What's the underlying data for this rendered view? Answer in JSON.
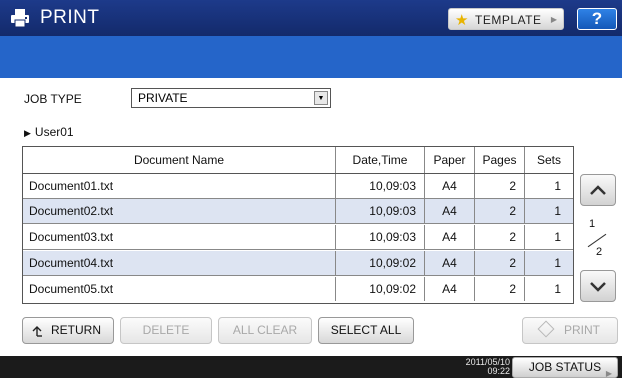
{
  "header": {
    "title": "PRINT",
    "title_icon": "printer-icon",
    "template_label": "TEMPLATE",
    "template_icon": "star-icon",
    "help_label": "?"
  },
  "filter": {
    "job_type_label": "JOB TYPE",
    "job_type_value": "PRIVATE"
  },
  "user": {
    "name": "User01"
  },
  "table": {
    "columns": [
      "Document Name",
      "Date,Time",
      "Paper",
      "Pages",
      "Sets"
    ],
    "rows": [
      {
        "name": "Document01.txt",
        "datetime": "10,09:03",
        "paper": "A4",
        "pages": "2",
        "sets": "1"
      },
      {
        "name": "Document02.txt",
        "datetime": "10,09:03",
        "paper": "A4",
        "pages": "2",
        "sets": "1"
      },
      {
        "name": "Document03.txt",
        "datetime": "10,09:03",
        "paper": "A4",
        "pages": "2",
        "sets": "1"
      },
      {
        "name": "Document04.txt",
        "datetime": "10,09:02",
        "paper": "A4",
        "pages": "2",
        "sets": "1"
      },
      {
        "name": "Document05.txt",
        "datetime": "10,09:02",
        "paper": "A4",
        "pages": "2",
        "sets": "1"
      }
    ]
  },
  "pager": {
    "current": "1",
    "total": "2"
  },
  "actions": {
    "return_label": "RETURN",
    "delete_label": "DELETE",
    "all_clear_label": "ALL CLEAR",
    "select_all_label": "SELECT ALL",
    "print_label": "PRINT"
  },
  "status": {
    "date": "2011/05/10",
    "time": "09:22",
    "job_status_label": "JOB STATUS"
  },
  "colors": {
    "title_bar": "#132a6b",
    "blue_band": "#2565c9",
    "alt_row": "#dde4f2",
    "help_button": "#1458b8"
  }
}
